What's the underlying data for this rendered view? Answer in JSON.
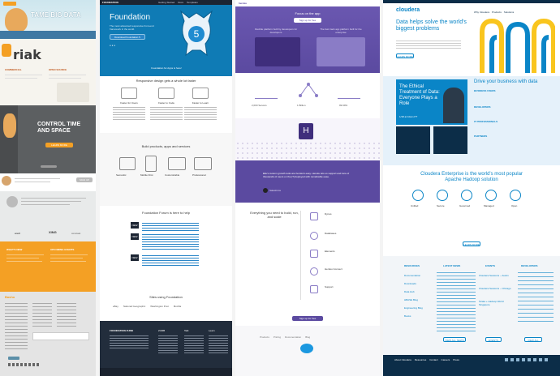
{
  "c1": {
    "hero1_title": "TAME BIG DATA",
    "hero2_title": "riak",
    "hero2_cols": [
      "COMMERCIAL",
      "OPEN SOURCE"
    ],
    "hero3_title": "CONTROL TIME AND SPACE",
    "hero3_btn": "LEARN MORE",
    "promo_btn": "SIGN UP",
    "logos": [
      "wadl",
      "XING",
      "comcast"
    ],
    "orange_heads": [
      "WHAT'S NEW",
      "UPCOMING EVENTS"
    ],
    "footer_brand": "Basho",
    "colors": {
      "orange": "#f4a024",
      "teal": "#5b8fa8",
      "gray": "#5c5f61"
    }
  },
  "c2": {
    "brand": "FOUNDATION",
    "nav": [
      "Getting Started",
      "Docs",
      "Templates",
      "Business",
      "Kits"
    ],
    "hero_title": "Foundation",
    "hero_sub": "The most advanced responsive front-end framework in the world.",
    "hero_btn": "Download Foundation 5",
    "hero_link": "Foundation for Apps is here!",
    "sec1_title": "Responsive design gets a whole lot faster",
    "features": [
      {
        "title": "Faster for Users",
        "text": "Foundation is built with speed in mind."
      },
      {
        "title": "Faster to Code",
        "text": "Modular and easy to customize."
      },
      {
        "title": "Faster to Learn",
        "text": "Tons of docs and resources."
      }
    ],
    "sec2_title": "Build products, apps and services",
    "devices": [
      "Semantic",
      "Mobile First",
      "Customizable",
      "Professional"
    ],
    "sec3_title": "Foundation Forum is here to help",
    "forum_badge": "NEW",
    "sites_title": "Sites using Foundation",
    "sites": [
      "eBay",
      "National Geographic",
      "Washington Post",
      "Mozilla",
      "Yahoo"
    ],
    "footer_heads": [
      "FOUNDATION ZURB",
      "ZURB",
      "Talk",
      "Learn"
    ],
    "colors": {
      "navy": "#222d3c",
      "blue": "#0f7bb5",
      "accent": "#2a86c8"
    }
  },
  "c3": {
    "brand": "heroku",
    "hero_title": "Focus on the app",
    "hero_btn": "Sign up for free",
    "hero_col1": "Flexible platform built by developers for developers",
    "hero_col2": "The fast track app platform built for the enterprise",
    "stat1": "2,000 Servers",
    "stat2": "1 Billion",
    "stat3": "99.99%",
    "quote": "Elle's custom growth tools are heroku's easy. Heroku lets us support and tons of thousands of users on the [?] deployed with remarkable ease.",
    "quote_author": "Salesforce",
    "sec_title": "Everything you need to build, run, and scale",
    "items": [
      "Dynos",
      "Databases",
      "Elements",
      "Heroku Connect",
      "Support"
    ],
    "cta_btn": "Sign up for free",
    "footer_links": [
      "Products",
      "Pricing",
      "Documentation",
      "Blog",
      "Careers",
      "About"
    ],
    "colors": {
      "purple": "#5b4aa0",
      "deep": "#3f2e7c",
      "light": "#efe9f6"
    }
  },
  "c4": {
    "brand": "cloudera",
    "nav": [
      "Why Cloudera",
      "Products",
      "Services & Support",
      "Solutions",
      "Get Started"
    ],
    "hero_title": "Data helps solve the world's biggest problems",
    "hero_btn": "LEARN MORE",
    "promo_title": "The Ethical Treatment of Data: Everyone Plays a Role",
    "promo_date": "1/18 at 10am PT",
    "promo_btn": "REGISTER NOW",
    "drive_title": "Drive your business with data",
    "drive_items": [
      "BUSINESS USERS",
      "DEVELOPERS",
      "IT PROFESSIONALS",
      "PARTNERS"
    ],
    "enterprise_title": "Cloudera Enterprise is the world's most popular Apache Hadoop solution",
    "icons": [
      "Unified",
      "Secure",
      "Governed",
      "Managed",
      "Open"
    ],
    "enterprise_btn": "LEARN MORE",
    "footer_heads": [
      "RESOURCES",
      "LATEST NEWS",
      "EVENTS",
      "DEVELOPERS"
    ],
    "resources": [
      "Documentation",
      "Downloads",
      "Data Hub",
      "HBASE Blog",
      "Engineering Blog",
      "Books"
    ],
    "events": [
      "Cloudera Sessions – Austin",
      "Cloudera Sessions – Chicago",
      "Strata + Hadoop World Singapore"
    ],
    "news_btn": "VIEW ALL NEWS",
    "events_btn": "EVENTS",
    "dev_btn": "VIEW ALL",
    "bottom_links": [
      "About Cloudera",
      "Resources",
      "Contact",
      "Careers",
      "Press",
      "Documentation"
    ],
    "colors": {
      "blue": "#0a85c7",
      "yellow": "#f9c51e",
      "navy": "#0c2d48",
      "lightblue": "#e5f1fa"
    }
  }
}
